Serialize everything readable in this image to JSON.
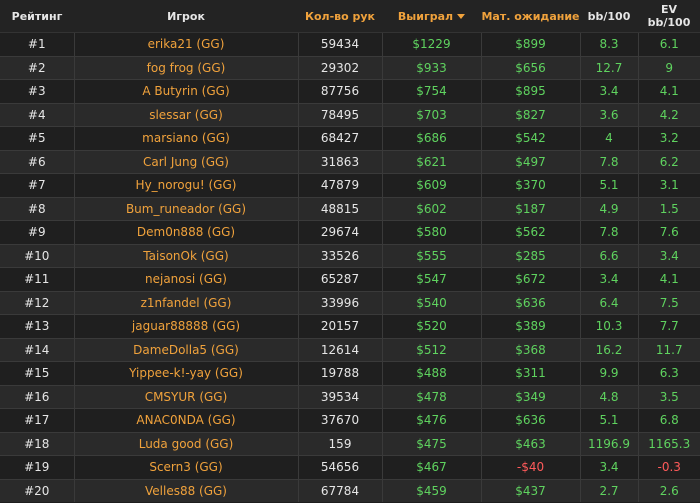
{
  "headers": {
    "rank": "Рейтинг",
    "player": "Игрок",
    "hands": "Кол-во рук",
    "won": "Выиграл",
    "ev": "Мат. ожидание",
    "bb": "bb/100",
    "evbb": "EV bb/100"
  },
  "colors": {
    "accent": "#f0a23c",
    "positive": "#5fd35f",
    "negative": "#ff5a5a"
  },
  "rows": [
    {
      "rank": "#1",
      "player": "erika21 (GG)",
      "hands": "59434",
      "won": "$1229",
      "ev": "$899",
      "bb": "8.3",
      "evbb": "6.1"
    },
    {
      "rank": "#2",
      "player": "fog frog (GG)",
      "hands": "29302",
      "won": "$933",
      "ev": "$656",
      "bb": "12.7",
      "evbb": "9"
    },
    {
      "rank": "#3",
      "player": "A Butyrin (GG)",
      "hands": "87756",
      "won": "$754",
      "ev": "$895",
      "bb": "3.4",
      "evbb": "4.1"
    },
    {
      "rank": "#4",
      "player": "slessar (GG)",
      "hands": "78495",
      "won": "$703",
      "ev": "$827",
      "bb": "3.6",
      "evbb": "4.2"
    },
    {
      "rank": "#5",
      "player": "marsiano (GG)",
      "hands": "68427",
      "won": "$686",
      "ev": "$542",
      "bb": "4",
      "evbb": "3.2"
    },
    {
      "rank": "#6",
      "player": "Carl Jung (GG)",
      "hands": "31863",
      "won": "$621",
      "ev": "$497",
      "bb": "7.8",
      "evbb": "6.2"
    },
    {
      "rank": "#7",
      "player": "Hy_norogu! (GG)",
      "hands": "47879",
      "won": "$609",
      "ev": "$370",
      "bb": "5.1",
      "evbb": "3.1"
    },
    {
      "rank": "#8",
      "player": "Bum_runeador (GG)",
      "hands": "48815",
      "won": "$602",
      "ev": "$187",
      "bb": "4.9",
      "evbb": "1.5"
    },
    {
      "rank": "#9",
      "player": "Dem0n888 (GG)",
      "hands": "29674",
      "won": "$580",
      "ev": "$562",
      "bb": "7.8",
      "evbb": "7.6"
    },
    {
      "rank": "#10",
      "player": "TaisonOk (GG)",
      "hands": "33526",
      "won": "$555",
      "ev": "$285",
      "bb": "6.6",
      "evbb": "3.4"
    },
    {
      "rank": "#11",
      "player": "nejanosi (GG)",
      "hands": "65287",
      "won": "$547",
      "ev": "$672",
      "bb": "3.4",
      "evbb": "4.1"
    },
    {
      "rank": "#12",
      "player": "z1nfandel (GG)",
      "hands": "33996",
      "won": "$540",
      "ev": "$636",
      "bb": "6.4",
      "evbb": "7.5"
    },
    {
      "rank": "#13",
      "player": "jaguar88888 (GG)",
      "hands": "20157",
      "won": "$520",
      "ev": "$389",
      "bb": "10.3",
      "evbb": "7.7"
    },
    {
      "rank": "#14",
      "player": "DameDolla5 (GG)",
      "hands": "12614",
      "won": "$512",
      "ev": "$368",
      "bb": "16.2",
      "evbb": "11.7"
    },
    {
      "rank": "#15",
      "player": "Yippee-k!-yay (GG)",
      "hands": "19788",
      "won": "$488",
      "ev": "$311",
      "bb": "9.9",
      "evbb": "6.3"
    },
    {
      "rank": "#16",
      "player": "CMSYUR (GG)",
      "hands": "39534",
      "won": "$478",
      "ev": "$349",
      "bb": "4.8",
      "evbb": "3.5"
    },
    {
      "rank": "#17",
      "player": "ANAC0NDA (GG)",
      "hands": "37670",
      "won": "$476",
      "ev": "$636",
      "bb": "5.1",
      "evbb": "6.8"
    },
    {
      "rank": "#18",
      "player": "Luda good (GG)",
      "hands": "159",
      "won": "$475",
      "ev": "$463",
      "bb": "1196.9",
      "evbb": "1165.3"
    },
    {
      "rank": "#19",
      "player": "Scern3 (GG)",
      "hands": "54656",
      "won": "$467",
      "ev": "-$40",
      "bb": "3.4",
      "evbb": "-0.3"
    },
    {
      "rank": "#20",
      "player": "Velles88 (GG)",
      "hands": "67784",
      "won": "$459",
      "ev": "$437",
      "bb": "2.7",
      "evbb": "2.6"
    }
  ]
}
